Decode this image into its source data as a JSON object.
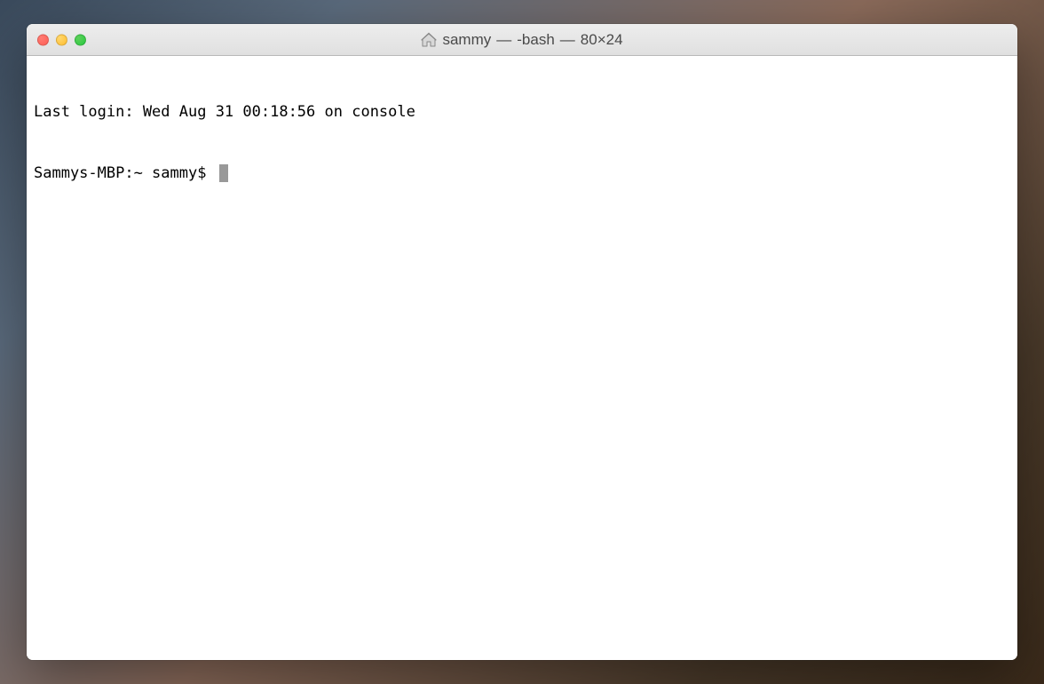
{
  "window": {
    "title_folder": "sammy",
    "title_shell": "-bash",
    "title_dimensions": "80×24"
  },
  "terminal": {
    "last_login": "Last login: Wed Aug 31 00:18:56 on console",
    "prompt": "Sammys-MBP:~ sammy$ "
  }
}
